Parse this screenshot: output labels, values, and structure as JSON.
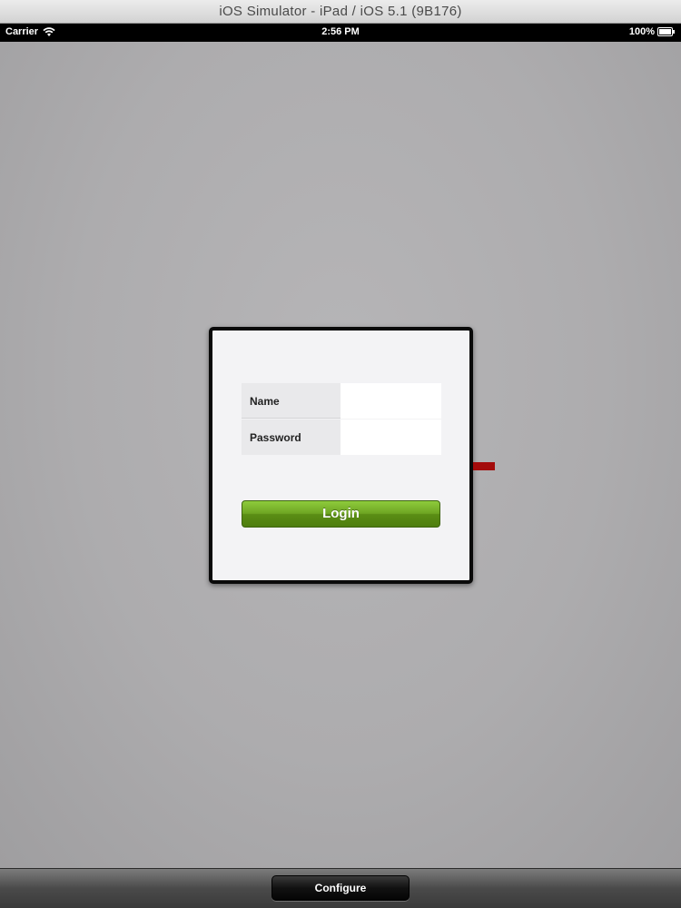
{
  "window": {
    "title": "iOS Simulator - iPad / iOS 5.1 (9B176)"
  },
  "statusbar": {
    "carrier": "Carrier",
    "time": "2:56 PM",
    "battery": "100%",
    "icons": [
      "wifi-icon",
      "battery-icon"
    ]
  },
  "login_form": {
    "name_label": "Name",
    "name_value": "",
    "password_label": "Password",
    "password_value": "",
    "login_label": "Login"
  },
  "toolbar": {
    "configure_label": "Configure"
  },
  "colors": {
    "login_button": "#6ea522",
    "marker": "#a30b0b",
    "panel_border": "#0a0a0a"
  }
}
